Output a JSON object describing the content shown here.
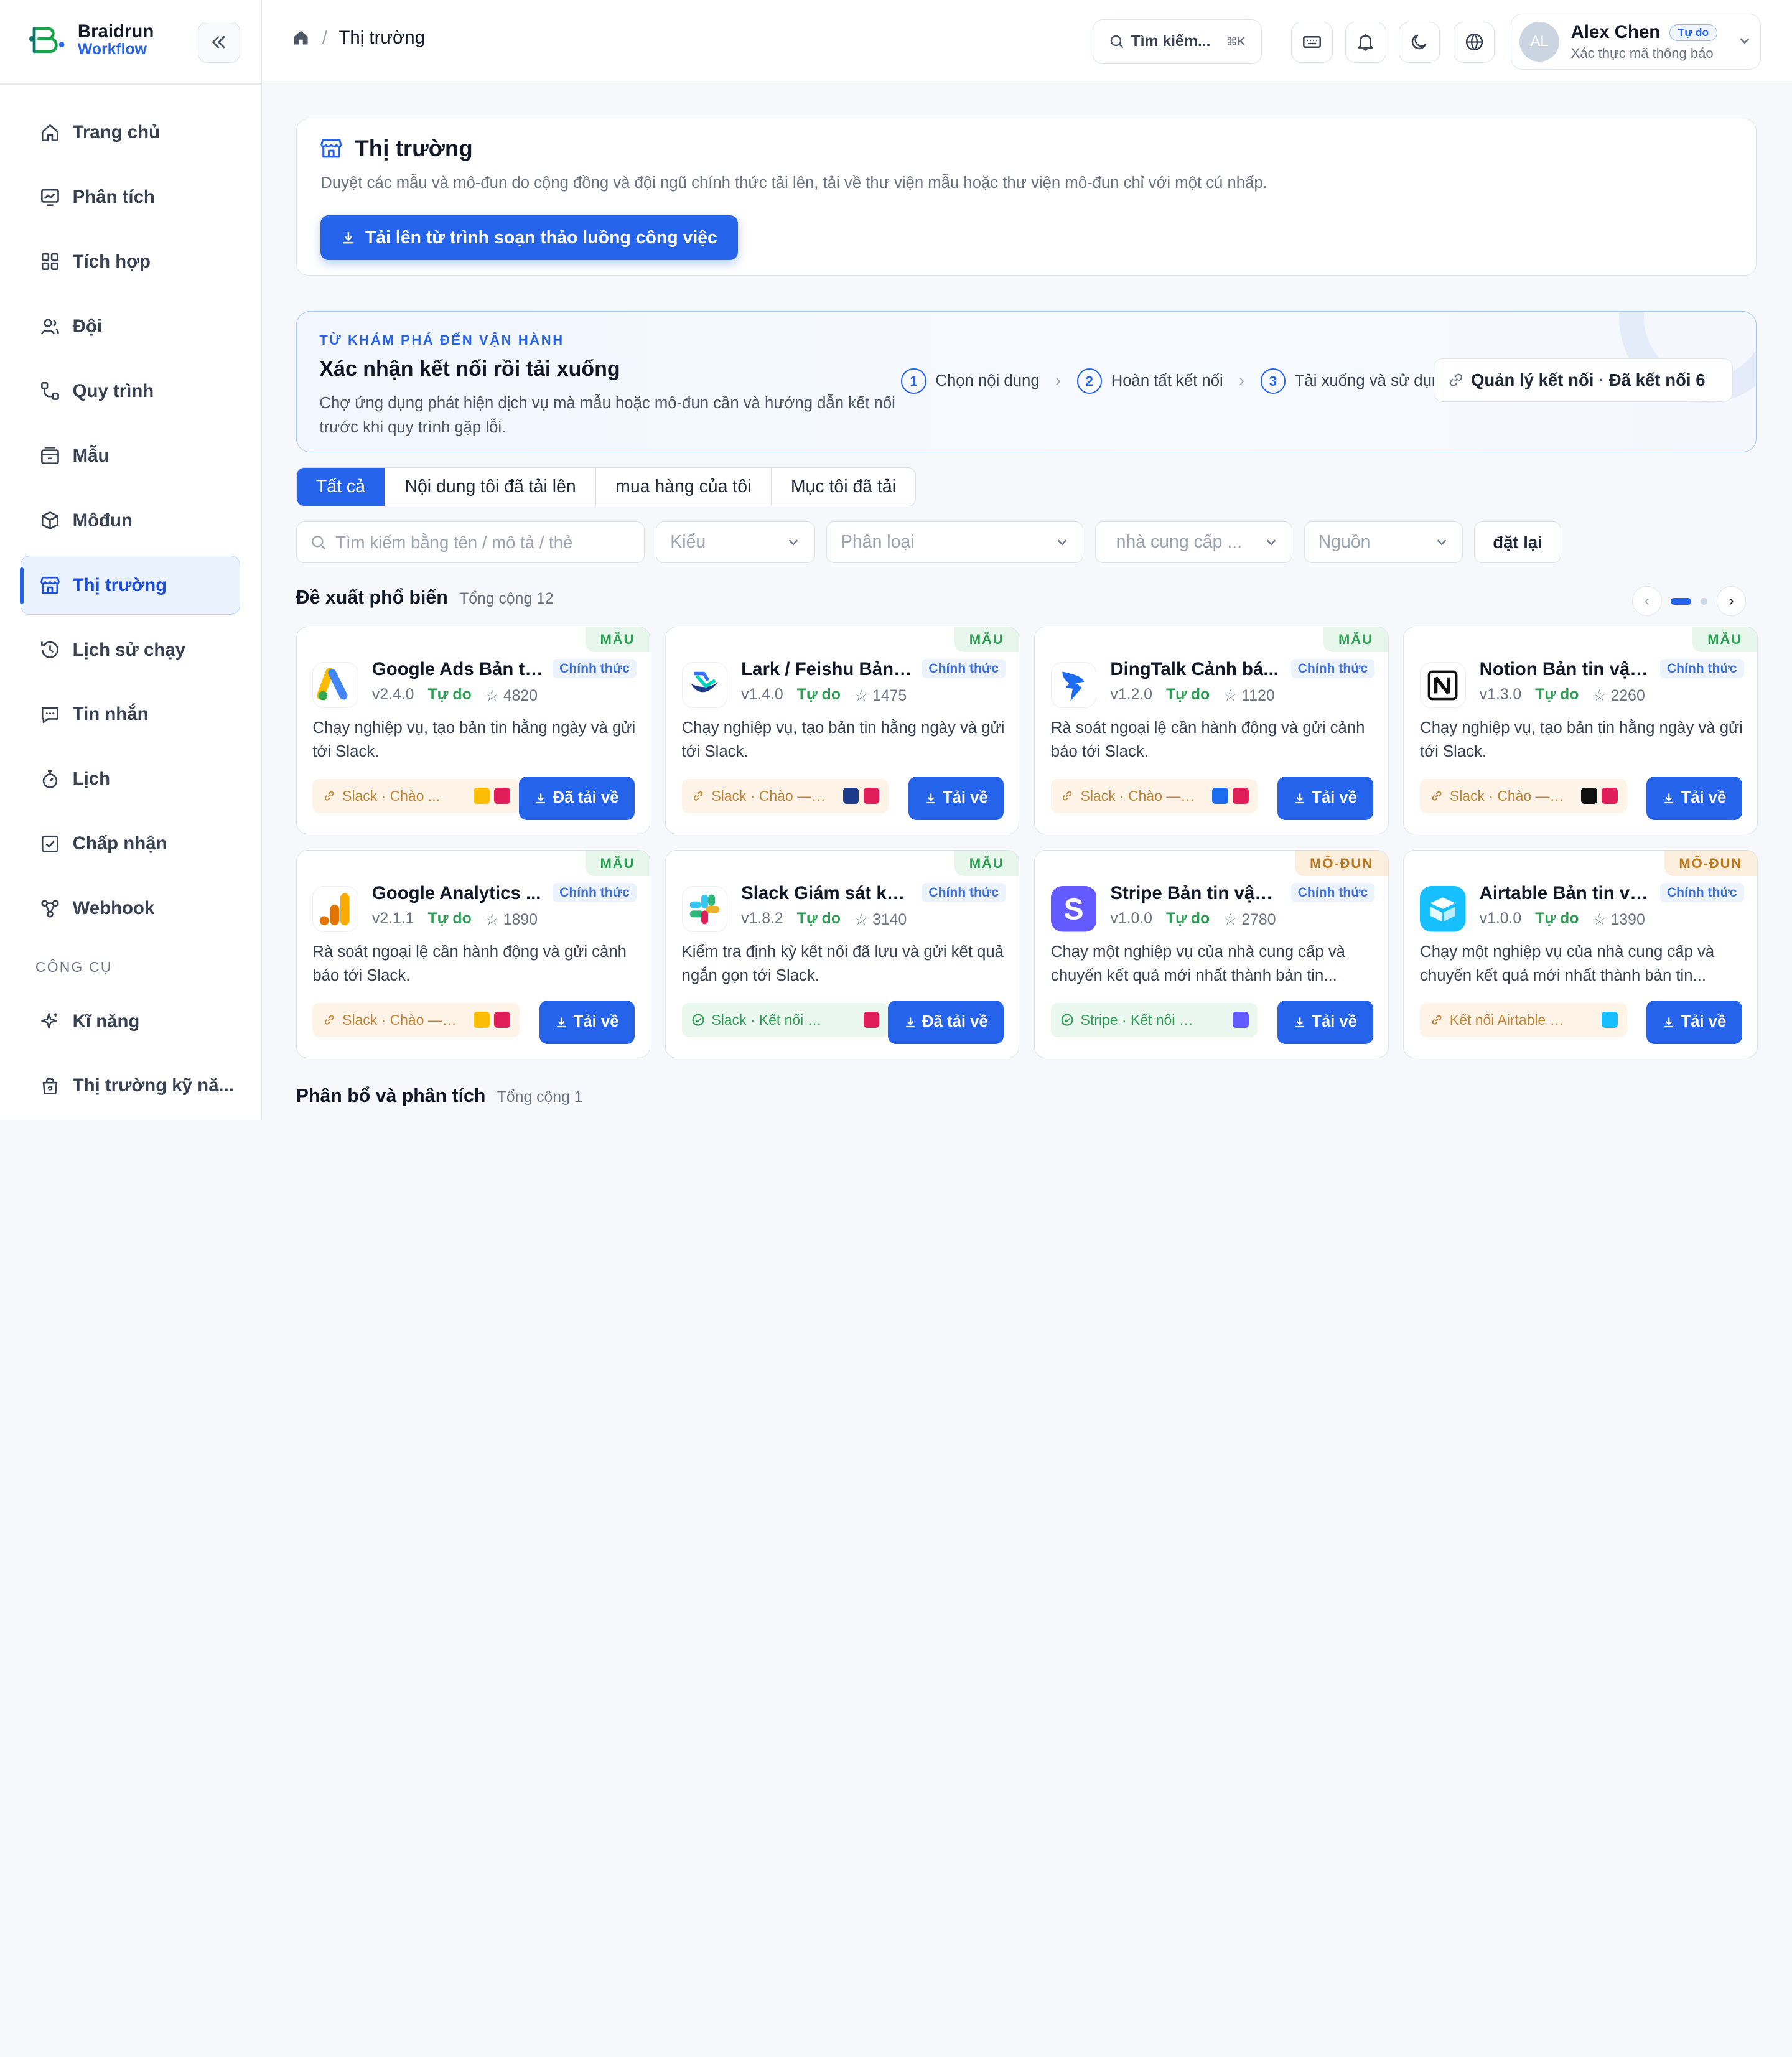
{
  "brand": {
    "name": "Braidrun",
    "sub": "Workflow"
  },
  "sidebar": {
    "items": [
      {
        "label": "Trang chủ",
        "icon": "home-icon"
      },
      {
        "label": "Phân tích",
        "icon": "chart-icon"
      },
      {
        "label": "Tích hợp",
        "icon": "grid-icon"
      },
      {
        "label": "Đội",
        "icon": "users-icon"
      },
      {
        "label": "Quy trình",
        "icon": "workflow-icon"
      },
      {
        "label": "Mẫu",
        "icon": "template-icon"
      },
      {
        "label": "Môđun",
        "icon": "cube-icon"
      },
      {
        "label": "Thị trường",
        "icon": "store-icon",
        "active": true
      },
      {
        "label": "Lịch sử chạy",
        "icon": "history-icon"
      },
      {
        "label": "Tin nhắn",
        "icon": "message-icon"
      },
      {
        "label": "Lịch",
        "icon": "timer-icon"
      },
      {
        "label": "Chấp nhận",
        "icon": "check-square-icon"
      },
      {
        "label": "Webhook",
        "icon": "webhook-icon"
      }
    ],
    "tools_section": "CÔNG CỤ",
    "tools": [
      {
        "label": "Kĩ năng",
        "icon": "sparkle-icon"
      },
      {
        "label": "Thị trường kỹ nă...",
        "icon": "bag-icon"
      }
    ]
  },
  "header": {
    "breadcrumb": "Thị trường",
    "search_label": "Tìm kiếm...",
    "search_kbd": "⌘K",
    "user": {
      "initials": "AL",
      "name": "Alex Chen",
      "plan": "Tự do",
      "sub": "Xác thực mã thông báo"
    }
  },
  "hero": {
    "title": "Thị trường",
    "desc": "Duyệt các mẫu và mô-đun do cộng đồng và đội ngũ chính thức tải lên, tải về thư viện mẫu hoặc thư viện mô-đun chỉ với một cú nhấp.",
    "upload_button": "Tải lên từ trình soạn thảo luồng công việc"
  },
  "flow": {
    "kicker": "TỪ KHÁM PHÁ ĐẾN VẬN HÀNH",
    "title": "Xác nhận kết nối rồi tải xuống",
    "desc": "Chợ ứng dụng phát hiện dịch vụ mà mẫu hoặc mô-đun cần và hướng dẫn kết nối trước khi quy trình gặp lỗi.",
    "steps": [
      {
        "num": "1",
        "label": "Chọn nội dung"
      },
      {
        "num": "2",
        "label": "Hoàn tất kết nối"
      },
      {
        "num": "3",
        "label": "Tải xuống và sử dụng"
      }
    ],
    "manage_button": "Quản lý kết nối · Đã kết nối 6"
  },
  "tabs": [
    "Tất cả",
    "Nội dung tôi đã tải lên",
    "mua hàng của tôi",
    "Mục tôi đã tải"
  ],
  "filters": {
    "search_placeholder": "Tìm kiếm bằng tên / mô tả / thẻ",
    "type": "Kiểu",
    "category": "Phân loại",
    "provider": "nhà cung cấp ...",
    "source": "Nguồn",
    "reset": "đặt lại"
  },
  "popular": {
    "title": "Đề xuất phổ biến",
    "count": "Tổng cộng 12"
  },
  "cards": [
    {
      "ribbon": "MẪU",
      "kind": "tpl",
      "icon": "google-ads-icon",
      "title": "Google Ads Bản ti...",
      "official": "Chính thức",
      "version": "v2.4.0",
      "price": "Tự do",
      "stars": "4820",
      "desc": "Chạy nghiệp vụ, tạo bản tin hằng ngày và gửi tới Slack.",
      "conn": "Slack · Chào ...",
      "conn_state": "warn",
      "minis": [
        "#fbbc04",
        "#e01e5a"
      ],
      "button": "Đã tải về"
    },
    {
      "ribbon": "MẪU",
      "kind": "tpl",
      "icon": "lark-icon",
      "title": "Lark / Feishu Bản t...",
      "official": "Chính thức",
      "version": "v1.4.0",
      "price": "Tự do",
      "stars": "1475",
      "desc": "Chạy nghiệp vụ, tạo bản tin hằng ngày và gửi tới Slack.",
      "conn": "Slack · Chào — K...",
      "conn_state": "warn",
      "minis": [
        "#1e3a8a",
        "#e01e5a"
      ],
      "button": "Tải về"
    },
    {
      "ribbon": "MẪU",
      "kind": "tpl",
      "icon": "dingtalk-icon",
      "title": "DingTalk Cảnh bá...",
      "official": "Chính thức",
      "version": "v1.2.0",
      "price": "Tự do",
      "stars": "1120",
      "desc": "Rà soát ngoại lệ cần hành động và gửi cảnh báo tới Slack.",
      "conn": "Slack · Chào — K...",
      "conn_state": "warn",
      "minis": [
        "#1d6cf0",
        "#e01e5a"
      ],
      "button": "Tải về"
    },
    {
      "ribbon": "MẪU",
      "kind": "tpl",
      "icon": "notion-icon",
      "title": "Notion Bản tin vận...",
      "official": "Chính thức",
      "version": "v1.3.0",
      "price": "Tự do",
      "stars": "2260",
      "desc": "Chạy nghiệp vụ, tạo bản tin hằng ngày và gửi tới Slack.",
      "conn": "Slack · Chào — K...",
      "conn_state": "warn",
      "minis": [
        "#111111",
        "#e01e5a"
      ],
      "button": "Tải về"
    },
    {
      "ribbon": "MẪU",
      "kind": "tpl",
      "icon": "google-analytics-icon",
      "title": "Google Analytics ...",
      "official": "Chính thức",
      "version": "v2.1.1",
      "price": "Tự do",
      "stars": "1890",
      "desc": "Rà soát ngoại lệ cần hành động và gửi cảnh báo tới Slack.",
      "conn": "Slack · Chào — K...",
      "conn_state": "warn",
      "minis": [
        "#fbbc04",
        "#e01e5a"
      ],
      "button": "Tải về"
    },
    {
      "ribbon": "MẪU",
      "kind": "tpl",
      "icon": "slack-icon",
      "title": "Slack Giám sát kết...",
      "official": "Chính thức",
      "version": "v1.8.2",
      "price": "Tự do",
      "stars": "3140",
      "desc": "Kiểm tra định kỳ kết nối đã lưu và gửi kết quả ngắn gọn tới Slack.",
      "conn": "Slack · Kết nối đã ...",
      "conn_state": "ok",
      "minis": [
        "#e01e5a"
      ],
      "button": "Đã tải về"
    },
    {
      "ribbon": "MÔ-ĐUN",
      "kind": "mod",
      "icon": "stripe-icon",
      "title": "Stripe Bản tin vận ...",
      "official": "Chính thức",
      "version": "v1.0.0",
      "price": "Tự do",
      "stars": "2780",
      "desc": "Chạy một nghiệp vụ của nhà cung cấp và chuyển kết quả mới nhất thành bản tin...",
      "conn": "Stripe · Kết nối đã sẵ...",
      "conn_state": "ok",
      "minis": [
        "#635bff"
      ],
      "button": "Tải về"
    },
    {
      "ribbon": "MÔ-ĐUN",
      "kind": "mod",
      "icon": "airtable-icon",
      "title": "Airtable Bản tin vậ...",
      "official": "Chính thức",
      "version": "v1.0.0",
      "price": "Tự do",
      "stars": "1390",
      "desc": "Chạy một nghiệp vụ của nhà cung cấp và chuyển kết quả mới nhất thành bản tin...",
      "conn": "Kết nối Airtable trước",
      "conn_state": "warn",
      "minis": [
        "#18bfff"
      ],
      "button": "Tải về"
    }
  ],
  "distribution": {
    "title": "Phân bổ và phân tích",
    "count": "Tổng cộng 1"
  },
  "colors": {
    "primary": "#2563eb",
    "success": "#2f9e55",
    "warning": "#c08439"
  }
}
